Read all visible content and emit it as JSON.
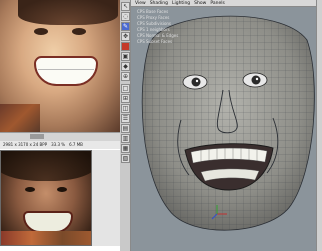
{
  "status_bar": {
    "size": "2981 x 3170 x 24 BPP",
    "zoom": "33.3 %",
    "memory": "6.7 MB"
  },
  "viewport": {
    "menu": [
      "View",
      "Shading",
      "Lighting",
      "Show",
      "Panels"
    ],
    "overlay_items": [
      "CPS Base Faces",
      "CPS Proxy Faces",
      "CPS Subdivisions",
      "CPS 1 neighbors",
      "CPS Normal & Edges",
      "CPS Subset Faces"
    ]
  },
  "toolbar": {
    "icons": [
      "select-tool-icon",
      "lasso-tool-icon",
      "paint-tool-icon",
      "move-tool-icon",
      "rotate-tool-icon",
      "scale-tool-icon",
      "manipulator-icon",
      "snap-icon",
      "layout-single-icon",
      "layout-four-icon",
      "layout-side-icon",
      "layout-stack-icon",
      "layout-outliner-icon",
      "layout-graph-icon",
      "layout-hypershade-icon",
      "layout-render-icon"
    ]
  }
}
